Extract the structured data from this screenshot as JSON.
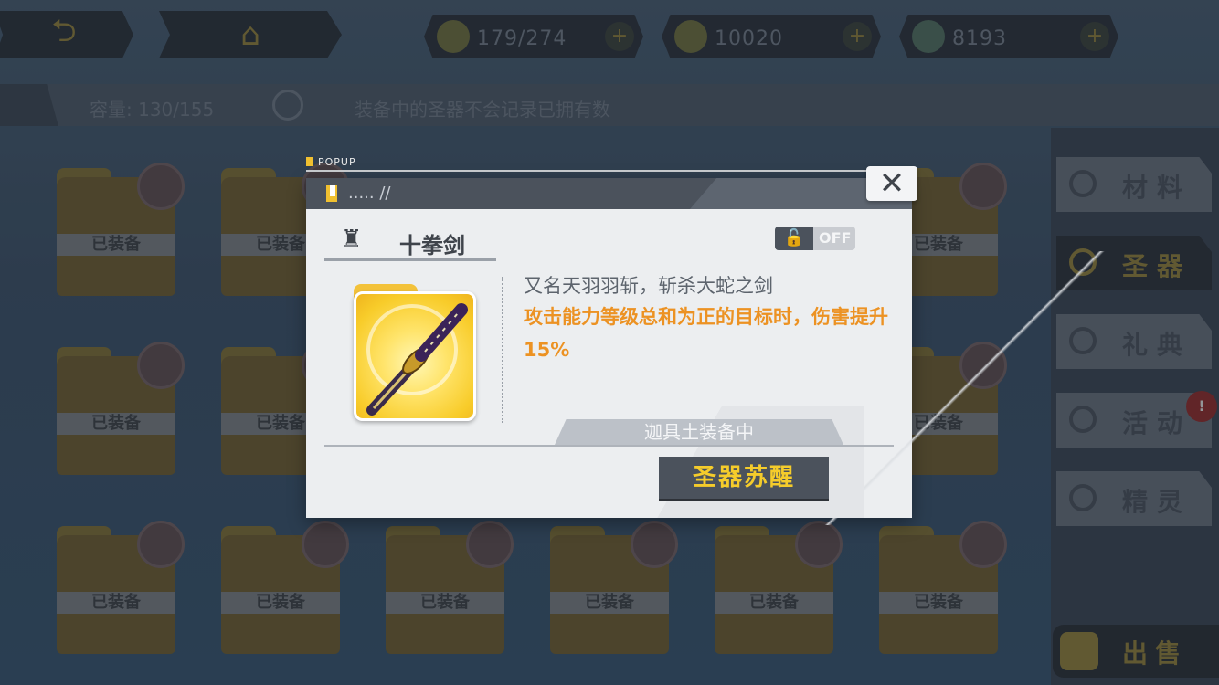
{
  "topbar": {
    "back_icon": "back-arrow-icon",
    "home_icon": "home-icon",
    "resources": [
      {
        "name": "stamina",
        "icon": "stamina-icon",
        "caption": "",
        "value": "179/274"
      },
      {
        "name": "coins",
        "icon": "coin-icon",
        "caption": "",
        "value": "10020"
      },
      {
        "name": "gems",
        "icon": "gem-icon",
        "caption": "",
        "value": "8193"
      }
    ],
    "plus_label": "+"
  },
  "capacity_bar": {
    "capacity_text": "容量: 130/155",
    "note": "装备中的圣器不会记录已拥有数"
  },
  "grid": {
    "equipped_label": "已装备"
  },
  "side_nav": {
    "items": [
      {
        "label": "材料",
        "icon": "material-icon"
      },
      {
        "label": "圣器",
        "icon": "holy-relic-icon",
        "active": true
      },
      {
        "label": "礼典",
        "icon": "ritual-icon"
      },
      {
        "label": "活动",
        "icon": "event-icon"
      },
      {
        "label": "精灵",
        "icon": "spirit-icon"
      }
    ],
    "sell_label": "出售",
    "badge": "!"
  },
  "popup": {
    "tag": "POPUP",
    "header_text": "..... //",
    "close_label": "✕",
    "item_name": "十拳剑",
    "lock_state": "OFF",
    "description": "又名天羽羽斩，斩杀大蛇之剑",
    "effect": "攻击能力等级总和为正的目标时，伤害提升15%",
    "equipped_status": "迦具土装备中",
    "awaken_button": "圣器苏醒"
  },
  "colors": {
    "accent_yellow": "#f5cc2b",
    "effect_orange": "#ec9223",
    "popup_bg": "#eceef0",
    "dark_btn": "#4b525c"
  }
}
